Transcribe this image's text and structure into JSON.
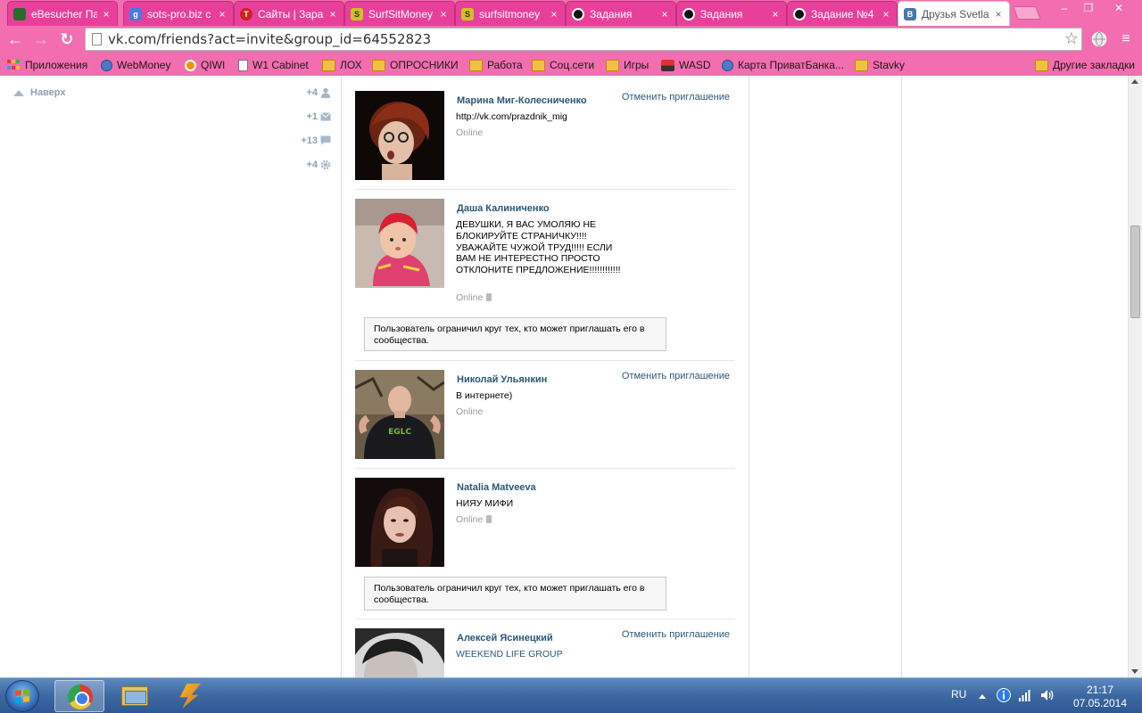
{
  "browser": {
    "tabs": [
      {
        "title": "eBesucher Па",
        "favicon": "ebesucher-favicon",
        "fav_color": "#2a6a2a",
        "fav_text": ""
      },
      {
        "title": "sots-pro.biz с",
        "favicon": "google-plus-favicon",
        "fav_color": "#4a7ae0",
        "fav_text": "g"
      },
      {
        "title": "Сайты | Зара",
        "favicon": "t-favicon",
        "fav_color": "#d02020",
        "fav_text": "T"
      },
      {
        "title": "SurfSitMoney",
        "favicon": "surfsitmoney-favicon",
        "fav_color": "#d0c020",
        "fav_text": "S"
      },
      {
        "title": "surfsitmoney",
        "favicon": "surfsitmoney-favicon",
        "fav_color": "#d0c020",
        "fav_text": "S"
      },
      {
        "title": "Задания",
        "favicon": "dark-circle-favicon",
        "fav_color": "#111111",
        "fav_text": ""
      },
      {
        "title": "Задания",
        "favicon": "dark-circle-favicon",
        "fav_color": "#111111",
        "fav_text": ""
      },
      {
        "title": "Задание №4",
        "favicon": "dark-circle-favicon",
        "fav_color": "#111111",
        "fav_text": ""
      },
      {
        "title": "Друзья Svetla",
        "favicon": "vk-favicon",
        "fav_color": "#4a76a8",
        "fav_text": "B"
      }
    ],
    "close_glyph": "×",
    "window_controls": {
      "minimize": "–",
      "maximize": "❐",
      "close": "✕"
    },
    "nav": {
      "back": "←",
      "forward": "→",
      "reload": "↻"
    },
    "url": "vk.com/friends?act=invite&group_id=64552823",
    "star_glyph": "☆",
    "menu_glyph": "≡",
    "bookmarks": [
      {
        "label": "Приложения",
        "icon": "apps-icon"
      },
      {
        "label": "WebMoney",
        "icon": "globe-icon"
      },
      {
        "label": "QIWI",
        "icon": "qiwi-icon"
      },
      {
        "label": "W1 Cabinet",
        "icon": "page-icon"
      },
      {
        "label": "ЛОХ",
        "icon": "folder-icon"
      },
      {
        "label": "ОПРОСНИКИ",
        "icon": "folder-icon"
      },
      {
        "label": "Работа",
        "icon": "folder-icon"
      },
      {
        "label": "Соц.сети",
        "icon": "folder-icon"
      },
      {
        "label": "Игры",
        "icon": "folder-icon"
      },
      {
        "label": "WASD",
        "icon": "wasd-icon"
      },
      {
        "label": "Карта ПриватБанка...",
        "icon": "globe-icon"
      },
      {
        "label": "Stavky",
        "icon": "folder-icon"
      }
    ],
    "other_bookmarks": "Другие закладки",
    "accent_color": "#f26eb0"
  },
  "sidebar": {
    "to_top": "Наверх",
    "counters": [
      {
        "value": "+4",
        "icon": "person-icon"
      },
      {
        "value": "+1",
        "icon": "mail-icon"
      },
      {
        "value": "+13",
        "icon": "comment-icon"
      },
      {
        "value": "+4",
        "icon": "gear-icon"
      }
    ]
  },
  "friends": [
    {
      "name": "Марина Миг-Колесниченко",
      "status": "http://vk.com/prazdnik_mig",
      "online": "Online",
      "mobile": false,
      "action": "Отменить приглашение",
      "restriction": ""
    },
    {
      "name": "Даша Калиниченко",
      "status": "ДЕВУШКИ, Я ВАС УМОЛЯЮ НЕ БЛОКИРУЙТЕ СТРАНИЧКУ!!!! УВАЖАЙТЕ ЧУЖОЙ ТРУД!!!!! ЕСЛИ ВАМ НЕ ИНТЕРЕСТНО ПРОСТО ОТКЛОНИТЕ ПРЕДЛОЖЕНИЕ!!!!!!!!!!!!",
      "online": "Online",
      "mobile": true,
      "action": "",
      "restriction": "Пользователь ограничил круг тех, кто может приглашать его в сообщества."
    },
    {
      "name": "Николай Ульянкин",
      "status": "В интернете)",
      "online": "Online",
      "mobile": false,
      "action": "Отменить приглашение",
      "restriction": ""
    },
    {
      "name": "Natalia Matveeva",
      "status": "НИЯУ МИФИ",
      "online": "Online",
      "mobile": true,
      "action": "",
      "restriction": "Пользователь ограничил круг тех, кто может приглашать его в сообщества."
    },
    {
      "name": "Алексей Ясинецкий",
      "status": "WEEKEND LIFE GROUP",
      "online": "",
      "mobile": false,
      "action": "Отменить приглашение",
      "restriction": ""
    }
  ],
  "taskbar": {
    "language": "RU",
    "time": "21:17",
    "date": "07.05.2014"
  }
}
